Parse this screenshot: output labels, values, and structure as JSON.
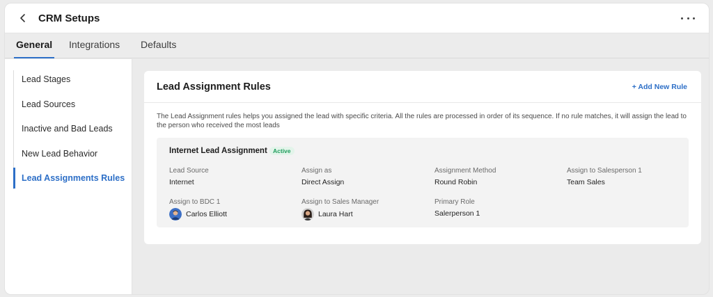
{
  "header": {
    "title": "CRM Setups"
  },
  "tabs": [
    {
      "label": "General",
      "active": true
    },
    {
      "label": "Integrations",
      "active": false
    },
    {
      "label": "Defaults",
      "active": false
    }
  ],
  "sidebar": {
    "items": [
      {
        "label": "Lead Stages"
      },
      {
        "label": "Lead Sources"
      },
      {
        "label": "Inactive and Bad Leads"
      },
      {
        "label": "New Lead Behavior"
      },
      {
        "label": "Lead Assignments Rules",
        "active": true
      }
    ]
  },
  "card": {
    "title": "Lead Assignment Rules",
    "add_rule_label": "+ Add New Rule",
    "description": "The Lead Assignment rules helps you assigned the lead with specific criteria. All the rules are processed in order of its sequence. If no rule matches, it will assign the lead to the person who received the most leads"
  },
  "rule": {
    "name": "Internet Lead Assignment",
    "status": "Active",
    "fields": {
      "lead_source": {
        "label": "Lead Source",
        "value": "Internet"
      },
      "assign_as": {
        "label": "Assign as",
        "value": "Direct Assign"
      },
      "assignment_method": {
        "label": "Assignment Method",
        "value": "Round Robin"
      },
      "salesperson_1": {
        "label": "Assign to Salesperson 1",
        "value": "Team Sales"
      },
      "bdc_1": {
        "label": "Assign to BDC 1",
        "value": "Carlos Elliott"
      },
      "sales_manager": {
        "label": "Assign to Sales Manager",
        "value": "Laura Hart"
      },
      "primary_role": {
        "label": "Primary Role",
        "value": "Salerperson 1"
      }
    }
  },
  "colors": {
    "accent": "#2d6fc7",
    "active_badge_text": "#1f9d5c",
    "active_badge_bg": "#e3f4ea"
  },
  "icons": {
    "back": "chevron-left-icon",
    "more": "more-horizontal-icon"
  }
}
